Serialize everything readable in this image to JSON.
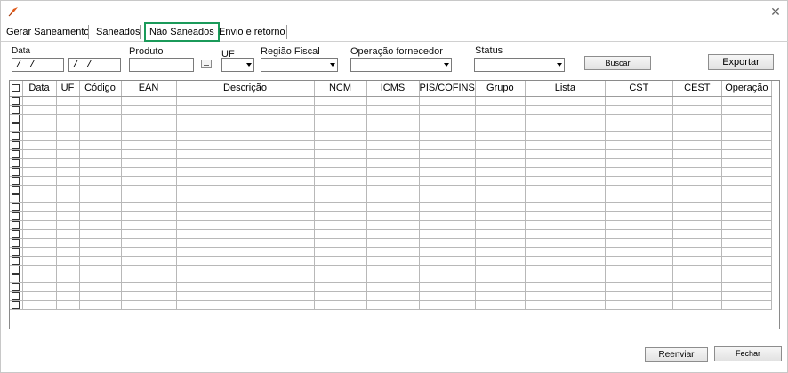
{
  "tabs": [
    {
      "label": "Gerar Saneamento"
    },
    {
      "label": "Saneados"
    },
    {
      "label": "Não Saneados",
      "active": true
    },
    {
      "label": "Envio e retorno"
    }
  ],
  "filters": {
    "date_label": "Data",
    "date_from": "/ /",
    "date_to": "/ /",
    "product_label": "Produto",
    "product_value": "",
    "uf_label": "UF",
    "uf_value": "",
    "region_label": "Região Fiscal",
    "region_value": "",
    "operation_label": "Operação fornecedor",
    "operation_value": "",
    "status_label": "Status",
    "status_value": ""
  },
  "buttons": {
    "search": "Buscar",
    "export": "Exportar",
    "resend": "Reenviar",
    "close": "Fechar"
  },
  "grid": {
    "columns": [
      "Data",
      "UF",
      "Código",
      "EAN",
      "Descrição",
      "NCM",
      "ICMS",
      "PIS/COFINS",
      "Grupo",
      "Lista",
      "CST",
      "CEST",
      "Operação"
    ],
    "empty_row_count": 24
  },
  "icons": {
    "app": "app-logo-icon",
    "close": "close-icon",
    "checkbox": "checkbox-icon",
    "dropdown": "chevron-down-icon"
  },
  "colors": {
    "active_tab_border": "#1b9a5a",
    "app_icon": "#e05a1a"
  }
}
